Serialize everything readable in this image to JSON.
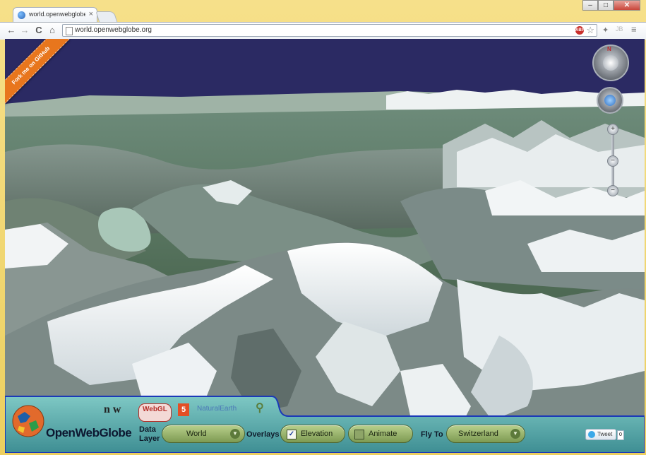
{
  "browser": {
    "tab_title": "world.openwebglobe.org",
    "tab_close": "×",
    "url": "world.openwebglobe.org",
    "minimize": "–",
    "maximize": "□",
    "close": "✕",
    "back": "←",
    "forward": "→",
    "reload": "C",
    "home": "⌂",
    "star": "☆",
    "menu": "≡",
    "abp_badge": "ABP"
  },
  "map": {
    "fork_ribbon": "Fork me on GitHub",
    "compass_n": "N",
    "zoom_in": "+",
    "zoom_mid": "−",
    "zoom_out": "−"
  },
  "footer": {
    "logo_text": "OpenWebGlobe",
    "data_layer_label": "Data\nLayer",
    "data_layer_value": "World",
    "overlays_label": "Overlays",
    "elevation_label": "Elevation",
    "elevation_checked": true,
    "animate_label": "Animate",
    "animate_checked": false,
    "fly_to_label": "Fly To",
    "fly_to_value": "Switzerland",
    "tweet_label": "Tweet",
    "tweet_count": "0",
    "partners": {
      "nw": "n w",
      "webgl": "WebGL",
      "html5": "5",
      "naturalearth": "NaturalEarth"
    }
  },
  "colors": {
    "sky": "#2b2a63",
    "ribbon": "#e8761d",
    "panel_teal": "#5fb3b4",
    "pill_green": "#9ab76e",
    "panel_border": "#1a39b8"
  }
}
